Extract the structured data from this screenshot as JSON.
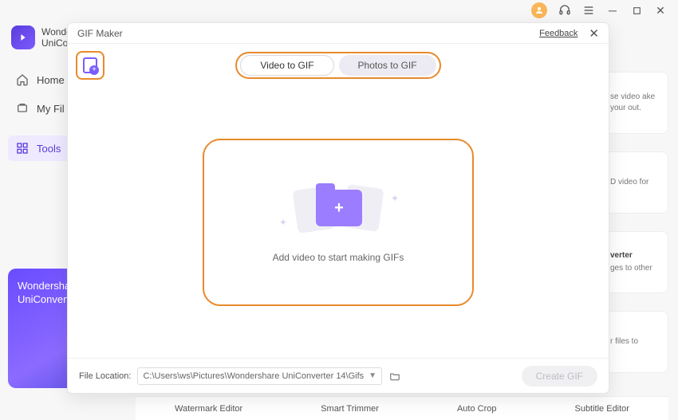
{
  "titlebar": {},
  "sidebar": {
    "brand1": "Wonde",
    "brand2": "UniCo",
    "items": [
      {
        "label": "Home"
      },
      {
        "label": "My Fil"
      },
      {
        "label": "Tools"
      }
    ]
  },
  "promo": {
    "line1": "Wondershare",
    "line2": "UniConverter"
  },
  "rightcards": [
    {
      "title": "",
      "text": "se video ake your out."
    },
    {
      "title": "",
      "text": "D video for"
    },
    {
      "title": "verter",
      "text": "ges to other"
    },
    {
      "title": "",
      "text": "r files to"
    }
  ],
  "bottomtools": [
    "Watermark Editor",
    "Smart Trimmer",
    "Auto Crop",
    "Subtitle Editor"
  ],
  "modal": {
    "title": "GIF Maker",
    "feedback": "Feedback",
    "tabs": {
      "active": "Video to GIF",
      "inactive": "Photos to GIF"
    },
    "dropText": "Add video to start making GIFs",
    "fileLocLabel": "File Location:",
    "fileLocPath": "C:\\Users\\ws\\Pictures\\Wondershare UniConverter 14\\Gifs",
    "createBtn": "Create GIF"
  }
}
